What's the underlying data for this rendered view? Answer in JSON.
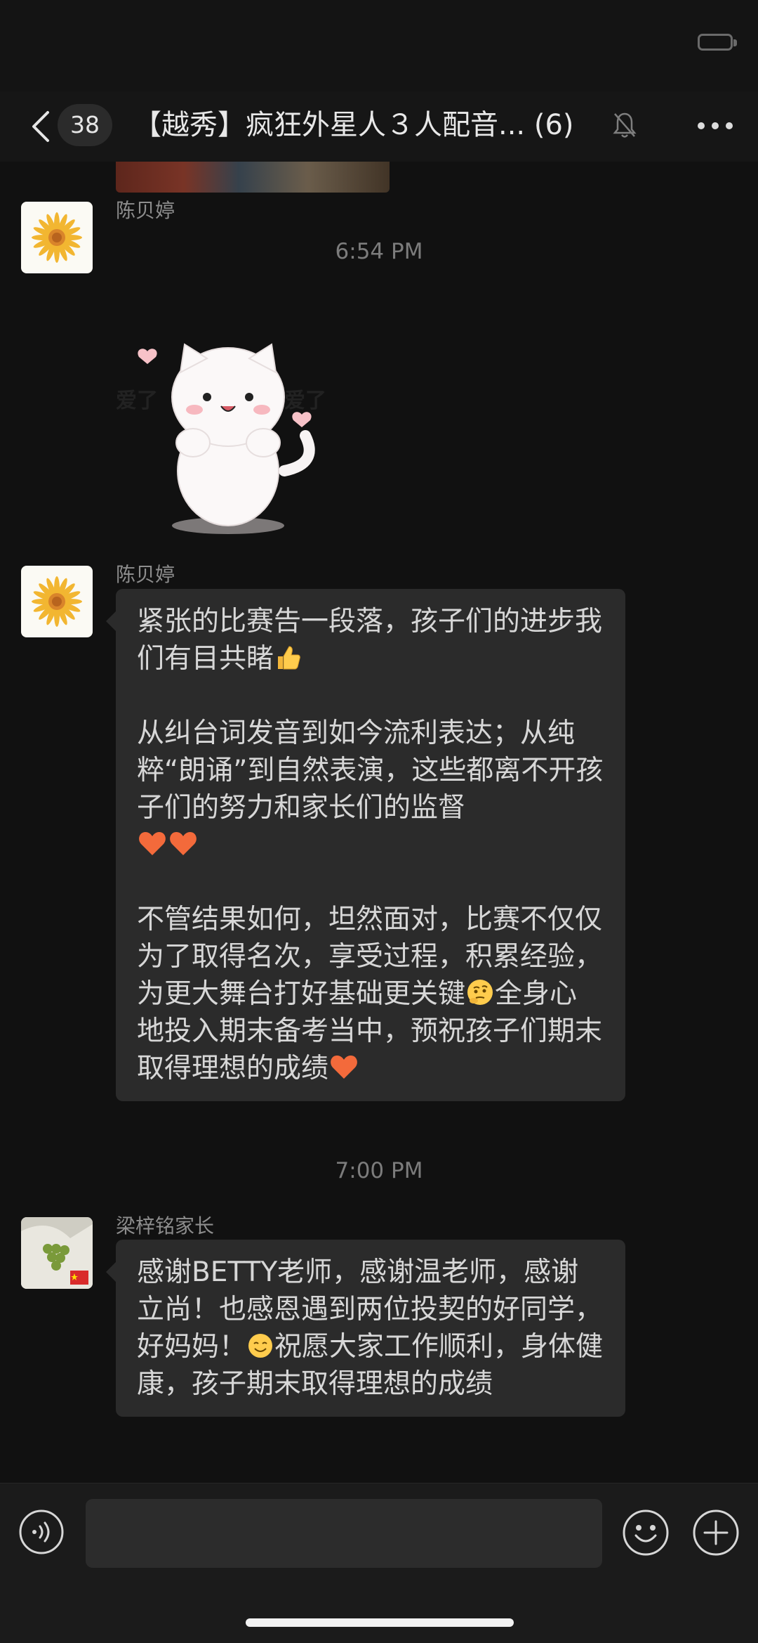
{
  "header": {
    "unread_count": "38",
    "title": "【越秀】疯狂外星人３人配音... (6)"
  },
  "messages": [
    {
      "type": "time",
      "text": "6:54 PM"
    },
    {
      "type": "sticker",
      "sender": "陈贝婷",
      "sticker_text_left": "爱了",
      "sticker_text_right": "爱了"
    },
    {
      "type": "text",
      "sender": "陈贝婷",
      "paragraphs": [
        "紧张的比赛告一段落，孩子们的进步我们有目共睹",
        "从纠台词发音到如今流利表达；从纯粹“朗诵”到自然表演，这些都离不开孩子们的努力和家长们的监督",
        "不管结果如何，坦然面对，比赛不仅仅为了取得名次，享受过程，积累经验，为更大舞台打好基础更关键",
        "全身心地投入期末备考当中，预祝孩子们期末取得理想的成绩"
      ]
    },
    {
      "type": "time",
      "text": "7:00 PM"
    },
    {
      "type": "text",
      "sender": "梁梓铭家长",
      "paragraphs": [
        "感谢BETTY老师，感谢温老师，感谢立尚！也感恩遇到两位投契的好同学，好妈妈！",
        "祝愿大家工作顺利，身体健康，孩子期末取得理想的成绩"
      ]
    }
  ],
  "icons": {
    "back": "chevron-left-icon",
    "mute": "bell-muted-icon",
    "more": "more-dots-icon",
    "voice": "voice-icon",
    "emoji": "smiley-icon",
    "plus": "plus-icon"
  },
  "colors": {
    "background": "#111111",
    "bubble": "#2b2b2b",
    "text": "#d7d7d7",
    "time": "#7c7c7c"
  }
}
